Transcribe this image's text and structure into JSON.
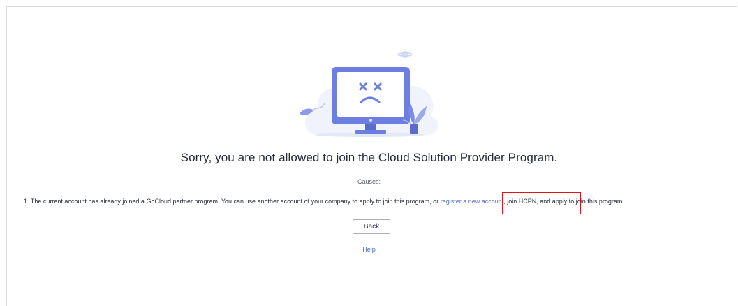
{
  "error": {
    "title": "Sorry, you are not allowed to join the Cloud Solution Provider Program.",
    "causes_heading": "Causes:",
    "cause_prefix": "1. The current account has already joined a GoCloud partner program. You can use another account of your company to apply to join this program, or ",
    "cause_link": "register a new account",
    "cause_suffix": ", join HCPN, and apply to join this program."
  },
  "actions": {
    "back_label": "Back",
    "help_label": "Help"
  },
  "illustration": {
    "icon": "sad-computer-monitor-icon"
  },
  "colors": {
    "accent": "#526ecc",
    "highlight_box": "#e0141e",
    "illustration_primary": "#6c7fe0"
  }
}
